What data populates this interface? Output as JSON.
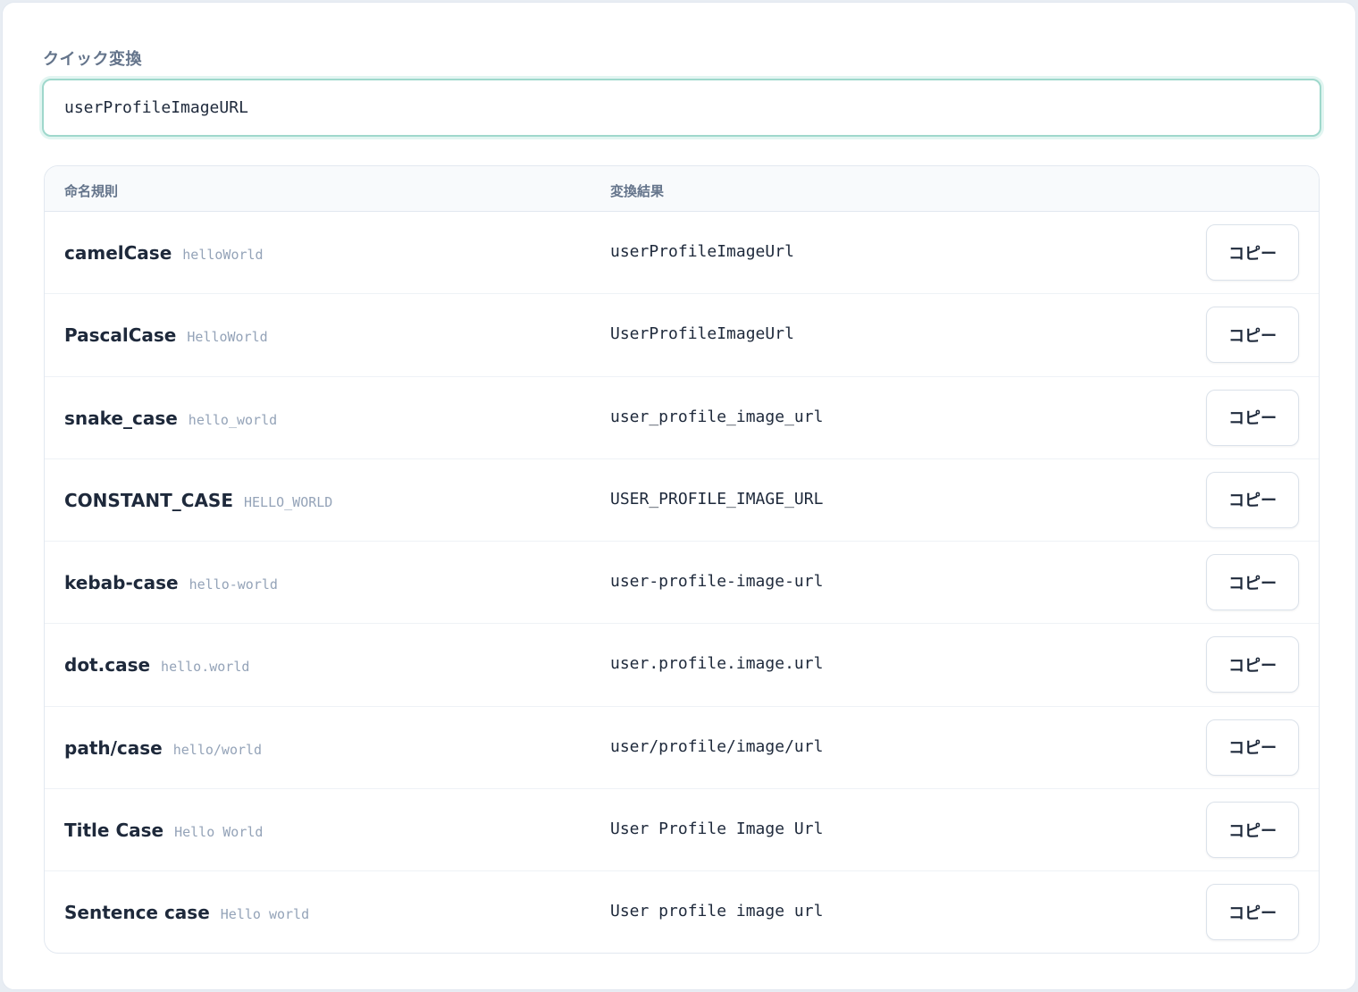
{
  "quick": {
    "label": "クイック変換",
    "input_value": "userProfileImageURL"
  },
  "table": {
    "headers": {
      "name": "命名規則",
      "result": "変換結果"
    },
    "copy_label": "コピー",
    "rows": [
      {
        "name": "camelCase",
        "example": "helloWorld",
        "result": "userProfileImageUrl"
      },
      {
        "name": "PascalCase",
        "example": "HelloWorld",
        "result": "UserProfileImageUrl"
      },
      {
        "name": "snake_case",
        "example": "hello_world",
        "result": "user_profile_image_url"
      },
      {
        "name": "CONSTANT_CASE",
        "example": "HELLO_WORLD",
        "result": "USER_PROFILE_IMAGE_URL"
      },
      {
        "name": "kebab-case",
        "example": "hello-world",
        "result": "user-profile-image-url"
      },
      {
        "name": "dot.case",
        "example": "hello.world",
        "result": "user.profile.image.url"
      },
      {
        "name": "path/case",
        "example": "hello/world",
        "result": "user/profile/image/url"
      },
      {
        "name": "Title Case",
        "example": "Hello World",
        "result": "User Profile Image Url"
      },
      {
        "name": "Sentence case",
        "example": "Hello world",
        "result": "User profile image url"
      }
    ]
  }
}
